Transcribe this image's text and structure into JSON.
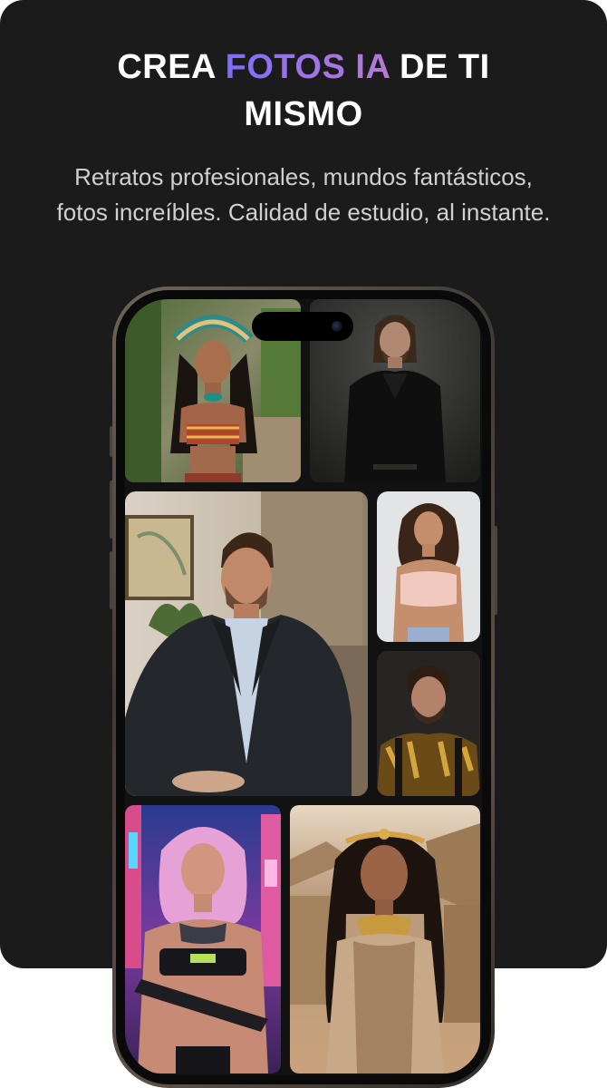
{
  "headline": {
    "line1_pre": "CREA ",
    "accent": "FOTOS IA",
    "line1_post": " DE TI",
    "line2": "MISMO"
  },
  "subtitle": "Retratos profesionales, mundos fantásticos, fotos increíbles. Calidad de estudio, al instante.",
  "colors": {
    "card_bg": "#1b1b1b",
    "accent_gradient_start": "#7b6df6",
    "accent_gradient_end": "#b57bd6"
  },
  "gallery": [
    {
      "id": "aztec-headdress-woman"
    },
    {
      "id": "man-black-suit"
    },
    {
      "id": "businessman-blazer"
    },
    {
      "id": "woman-pink-top"
    },
    {
      "id": "man-baroque-shirt"
    },
    {
      "id": "cyberpunk-woman"
    },
    {
      "id": "egyptian-woman"
    }
  ]
}
